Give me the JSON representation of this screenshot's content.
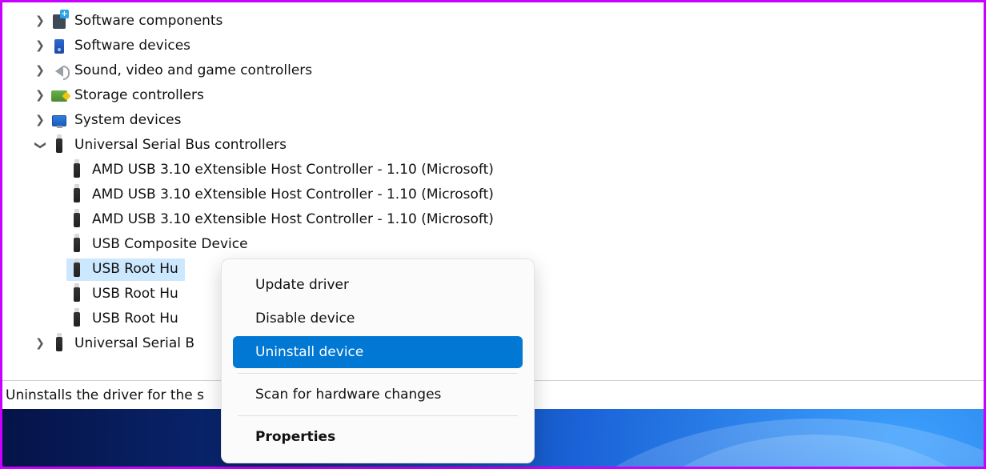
{
  "tree": {
    "collapsed": [
      {
        "icon": "software-components",
        "label": "Software components"
      },
      {
        "icon": "software-devices",
        "label": "Software devices"
      },
      {
        "icon": "sound",
        "label": "Sound, video and game controllers"
      },
      {
        "icon": "storage",
        "label": "Storage controllers"
      },
      {
        "icon": "system",
        "label": "System devices"
      }
    ],
    "expanded": {
      "label": "Universal Serial Bus controllers",
      "children": [
        "AMD USB 3.10 eXtensible Host Controller - 1.10 (Microsoft)",
        "AMD USB 3.10 eXtensible Host Controller - 1.10 (Microsoft)",
        "AMD USB 3.10 eXtensible Host Controller - 1.10 (Microsoft)",
        "USB Composite Device",
        "USB Root Hu",
        "USB Root Hu",
        "USB Root Hu"
      ],
      "selected_index": 4
    },
    "after": {
      "label": "Universal Serial B"
    }
  },
  "context_menu": {
    "items": [
      "Update driver",
      "Disable device",
      "Uninstall device",
      "Scan for hardware changes",
      "Properties"
    ],
    "highlighted_index": 2,
    "bold_index": 4
  },
  "status_bar": "Uninstalls the driver for the s"
}
